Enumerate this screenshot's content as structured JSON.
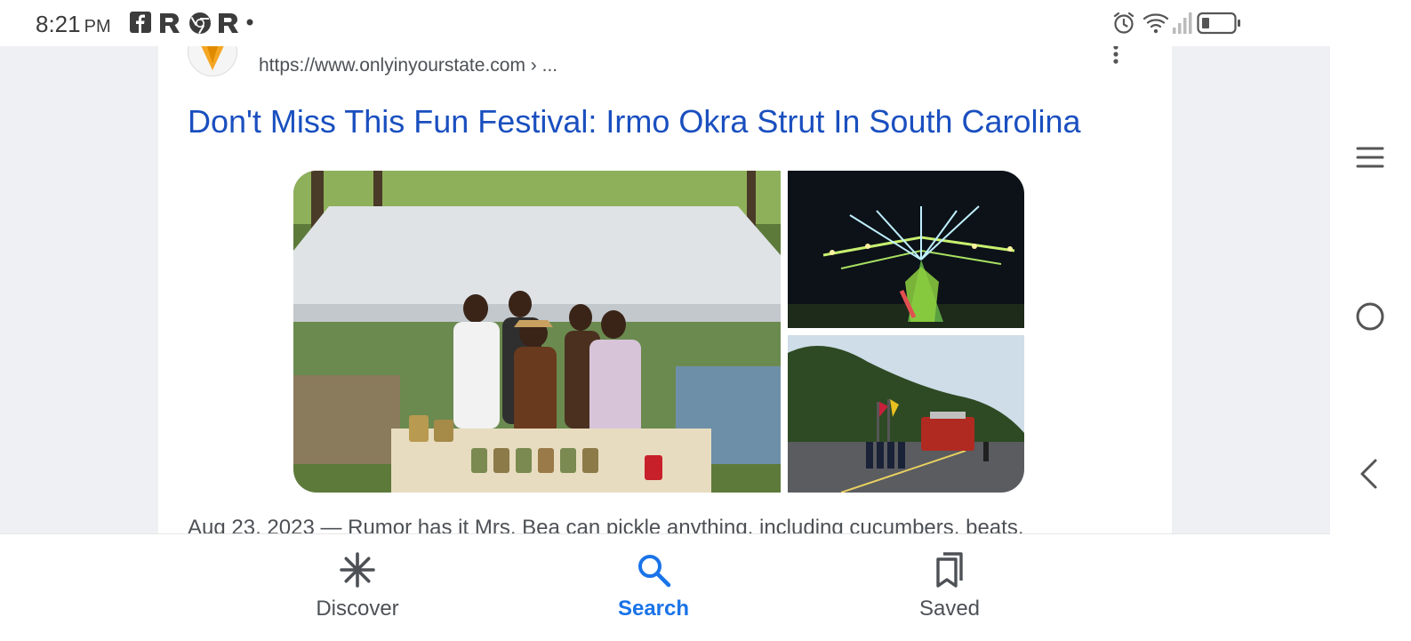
{
  "status_bar": {
    "time": "8:21",
    "ampm": "PM",
    "notification_icons": [
      "facebook-icon",
      "r-app-icon",
      "chrome-icon",
      "r-app-icon",
      "more-notifications-dot-icon"
    ],
    "system_icons": [
      "alarm-icon",
      "wifi-icon",
      "signal-icon",
      "battery-icon"
    ]
  },
  "result": {
    "url": "https://www.onlyinyourstate.com › ...",
    "title": "Don't Miss This Fun Festival: Irmo Okra Strut In South Carolina",
    "images": [
      "festival-vendors-photo",
      "carnival-ride-photo",
      "parade-photo"
    ],
    "snippet": "Aug 23, 2023 — Rumor has it Mrs. Bea can pickle anything, including cucumbers, beats,"
  },
  "bottom_nav": {
    "discover_label": "Discover",
    "search_label": "Search",
    "saved_label": "Saved",
    "active": "Search",
    "active_color": "#1a73e8"
  },
  "colors": {
    "link": "#1a4fbf",
    "page_bg": "#eef0f3",
    "text_secondary": "#4d5156"
  }
}
